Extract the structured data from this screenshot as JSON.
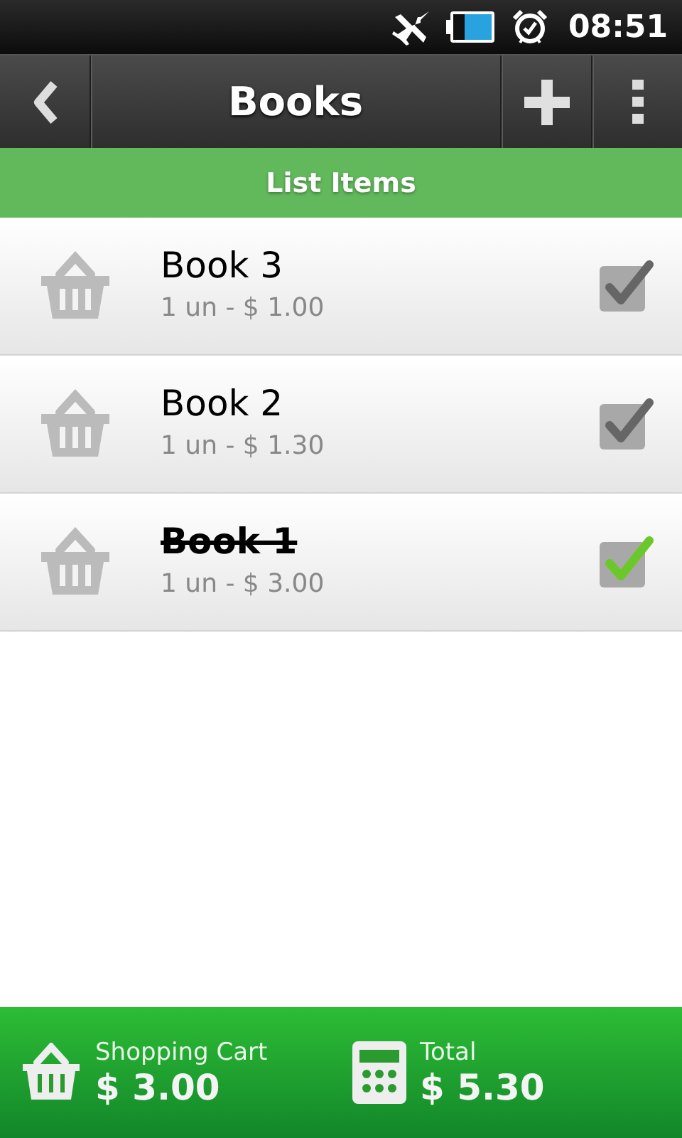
{
  "status_bar": {
    "time": "08:51"
  },
  "action_bar": {
    "title": "Books"
  },
  "section_header": "List Items",
  "items": [
    {
      "name": "Book 3",
      "detail": "1 un  -  $ 1.00",
      "checked": false
    },
    {
      "name": "Book 2",
      "detail": "1 un  -  $ 1.30",
      "checked": false
    },
    {
      "name": "Book 1",
      "detail": "1 un  -  $ 3.00",
      "checked": true
    }
  ],
  "footer": {
    "cart_label": "Shopping Cart",
    "cart_value": "$ 3.00",
    "total_label": "Total",
    "total_value": "$ 5.30"
  }
}
